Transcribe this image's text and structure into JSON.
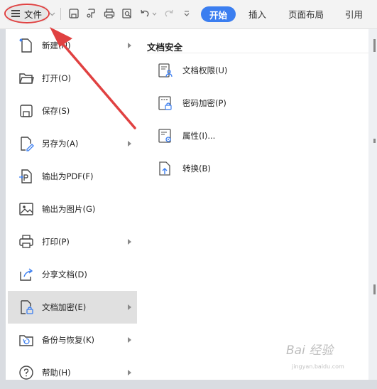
{
  "ribbon": {
    "file_label": "文件",
    "tabs": [
      {
        "label": "开始",
        "active": true
      },
      {
        "label": "插入",
        "active": false
      },
      {
        "label": "页面布局",
        "active": false
      },
      {
        "label": "引用",
        "active": false
      }
    ],
    "toolbar_icons": [
      "save-icon",
      "format-painter-icon",
      "print-icon",
      "print-preview-icon",
      "undo-icon",
      "redo-icon",
      "more-dropdown-icon"
    ],
    "accent_color": "#3b7ef0"
  },
  "menu": {
    "items": [
      {
        "label": "新建(N)",
        "icon": "new-icon",
        "has_submenu": true
      },
      {
        "label": "打开(O)",
        "icon": "open-folder-icon",
        "has_submenu": false
      },
      {
        "label": "保存(S)",
        "icon": "save-icon",
        "has_submenu": false
      },
      {
        "label": "另存为(A)",
        "icon": "save-as-icon",
        "has_submenu": true
      },
      {
        "label": "输出为PDF(F)",
        "icon": "pdf-icon",
        "has_submenu": false
      },
      {
        "label": "输出为图片(G)",
        "icon": "image-icon",
        "has_submenu": false
      },
      {
        "label": "打印(P)",
        "icon": "print-icon",
        "has_submenu": true
      },
      {
        "label": "分享文档(D)",
        "icon": "share-icon",
        "has_submenu": false
      },
      {
        "label": "文档加密(E)",
        "icon": "encrypt-icon",
        "has_submenu": true,
        "active": true
      },
      {
        "label": "备份与恢复(K)",
        "icon": "backup-icon",
        "has_submenu": true
      },
      {
        "label": "帮助(H)",
        "icon": "help-icon",
        "has_submenu": true
      }
    ]
  },
  "submenu": {
    "title": "文档安全",
    "items": [
      {
        "label": "文档权限(U)",
        "icon": "doc-permission-icon"
      },
      {
        "label": "密码加密(P)",
        "icon": "password-lock-icon"
      },
      {
        "label": "属性(I)...",
        "icon": "properties-icon"
      },
      {
        "label": "转换(B)",
        "icon": "convert-icon"
      }
    ]
  },
  "annotation": {
    "color": "#e04141"
  },
  "watermark": {
    "line1": "Bai 经验",
    "line2": "jingyan.baidu.com"
  }
}
